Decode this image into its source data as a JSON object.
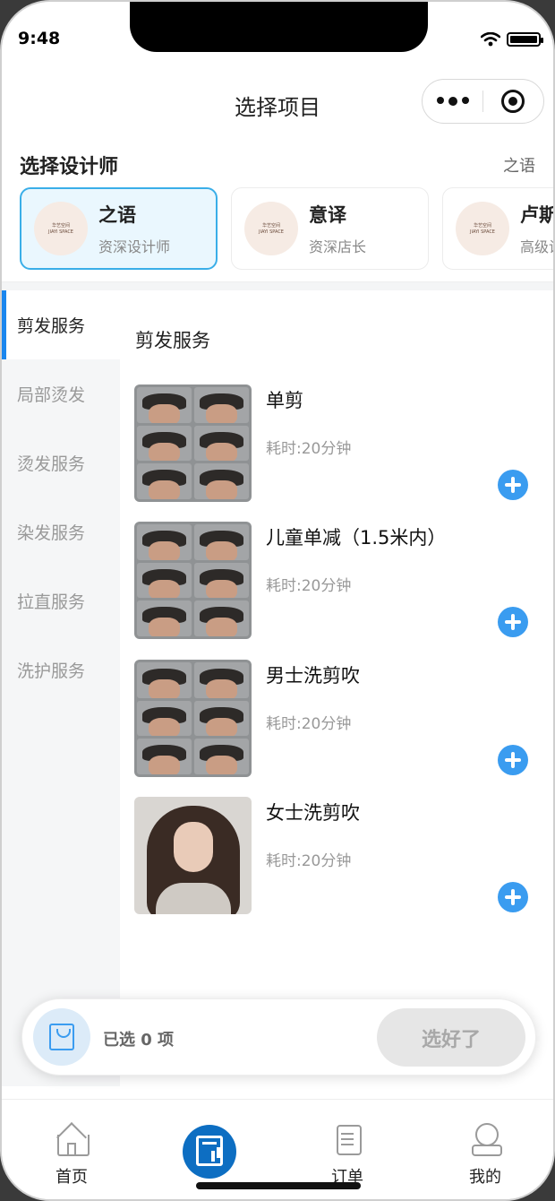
{
  "status": {
    "time": "9:48"
  },
  "nav": {
    "title": "选择项目"
  },
  "designers": {
    "section_title": "选择设计师",
    "selected_name": "之语",
    "logo_text": [
      "华艺空间",
      "JIAYI SPACE"
    ],
    "items": [
      {
        "name": "之语",
        "role": "资深设计师"
      },
      {
        "name": "意译",
        "role": "资深店长"
      },
      {
        "name": "卢斯",
        "role": "高级设计师"
      }
    ]
  },
  "categories": [
    "剪发服务",
    "局部烫发",
    "烫发服务",
    "染发服务",
    "拉直服务",
    "洗护服务"
  ],
  "main": {
    "title": "剪发服务",
    "services": [
      {
        "name": "单剪",
        "duration": "耗时:20分钟"
      },
      {
        "name": "儿童单减（1.5米内）",
        "duration": "耗时:20分钟"
      },
      {
        "name": "男士洗剪吹",
        "duration": "耗时:20分钟"
      },
      {
        "name": "女士洗剪吹",
        "duration": "耗时:20分钟"
      }
    ]
  },
  "cart": {
    "selected_text": "已选 0 项",
    "done_label": "选好了"
  },
  "tabbar": {
    "home": "首页",
    "orders": "订单",
    "me": "我的"
  },
  "colors": {
    "accent": "#3a9cf0",
    "active_border": "#3aaee8",
    "sidebar_indicator": "#1a86ee",
    "center_tab": "#0d6ec2"
  }
}
